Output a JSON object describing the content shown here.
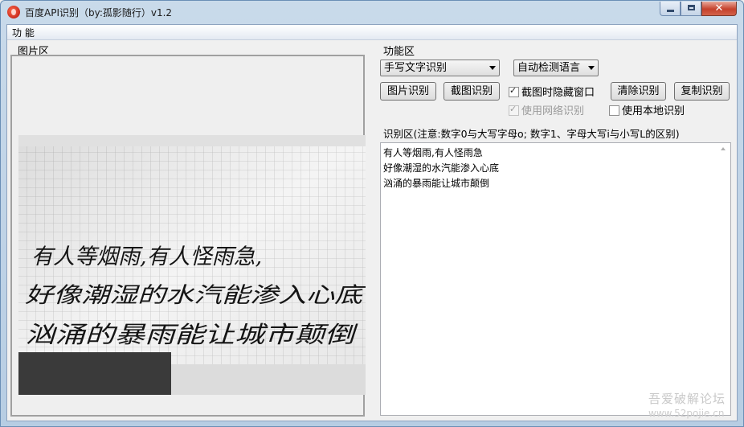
{
  "window": {
    "title": "百度API识别（by:孤影随行）v1.2"
  },
  "menu": {
    "items": [
      {
        "label": "功 能"
      }
    ]
  },
  "image_panel": {
    "label": "图片区",
    "handwriting": [
      "有人等烟雨,有人怪雨急,",
      "好像潮湿的水汽能渗入心底",
      "汹涌的暴雨能让城市颠倒"
    ]
  },
  "function_panel": {
    "label": "功能区",
    "mode_select": {
      "value": "手写文字识别"
    },
    "language_select": {
      "value": "自动检测语言"
    },
    "buttons": {
      "image_recognize": "图片识别",
      "screenshot_recognize": "截图识别",
      "clear": "清除识别",
      "copy": "复制识别"
    },
    "checkboxes": {
      "hide_window": {
        "label": "截图时隐藏窗口",
        "checked": true,
        "enabled": true
      },
      "network": {
        "label": "使用网络识别",
        "checked": true,
        "enabled": false
      },
      "local": {
        "label": "使用本地识别",
        "checked": false,
        "enabled": true
      }
    }
  },
  "result_panel": {
    "label": "识别区(注意:数字0与大写字母o; 数字1、字母大写i与小写L的区别)",
    "lines": [
      "有人等烟雨,有人怪雨急",
      "好像潮湿的水汽能渗入心底",
      "汹涌的暴雨能让城市颠倒"
    ]
  },
  "watermark": {
    "line1": "吾爱破解论坛",
    "line2": "www.52pojie.cn"
  }
}
